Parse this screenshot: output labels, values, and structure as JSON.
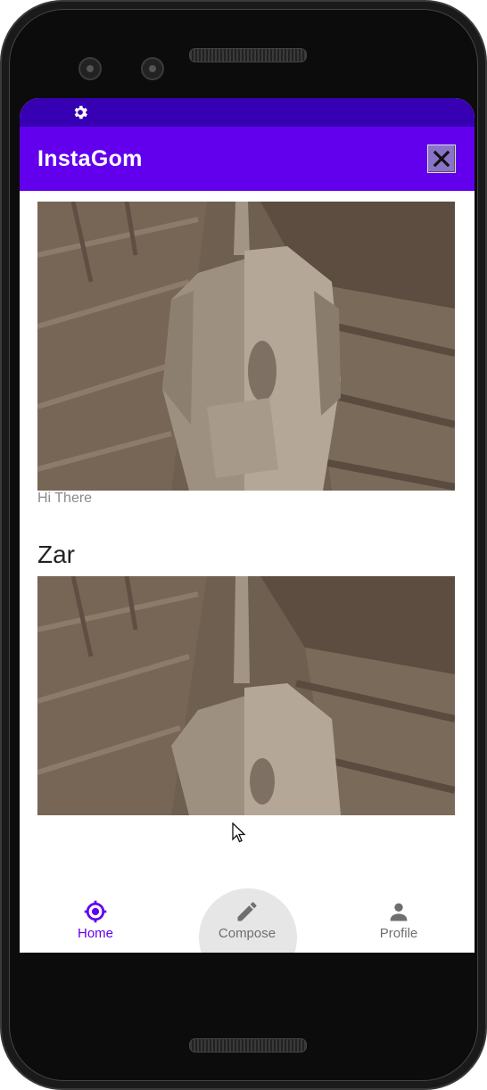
{
  "app": {
    "title": "InstaGom"
  },
  "status_bar": {
    "icon": "gear-icon"
  },
  "toolbar": {
    "close_icon": "close-icon"
  },
  "posts": [
    {
      "caption": "Hi There"
    },
    {
      "username": "Zar"
    }
  ],
  "bottom_nav": {
    "items": [
      {
        "label": "Home",
        "icon": "crosshair-icon",
        "active": true
      },
      {
        "label": "Compose",
        "icon": "pencil-icon",
        "active": false
      },
      {
        "label": "Profile",
        "icon": "person-icon",
        "active": false
      }
    ]
  },
  "colors": {
    "primary": "#6200ee",
    "primary_dark": "#3700b3",
    "nav_active": "#6200ee",
    "nav_inactive": "#6f6f6f"
  }
}
